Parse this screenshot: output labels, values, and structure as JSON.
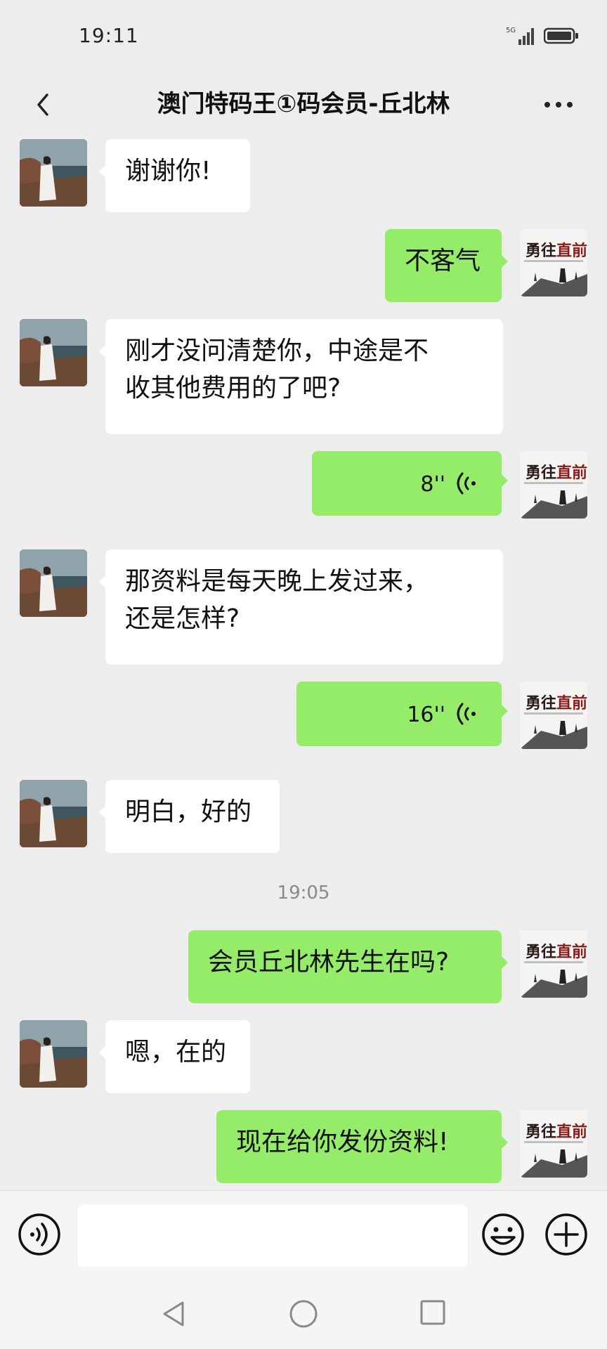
{
  "status_bar": {
    "time": "19:11",
    "network": "5G"
  },
  "header": {
    "title": "澳门特码王①码会员-丘北林"
  },
  "messages": [
    {
      "side": "left",
      "type": "text",
      "text": "谢谢你!"
    },
    {
      "side": "right",
      "type": "text",
      "text": "不客气"
    },
    {
      "side": "left",
      "type": "text",
      "lines": [
        "刚才没问清楚你，中途是不",
        "收其他费用的了吧?"
      ]
    },
    {
      "side": "right",
      "type": "voice",
      "duration": "8''"
    },
    {
      "side": "left",
      "type": "text",
      "lines": [
        "那资料是每天晚上发过来，",
        "还是怎样?"
      ]
    },
    {
      "side": "right",
      "type": "voice",
      "duration": "16''"
    },
    {
      "side": "left",
      "type": "text",
      "text": "明白，好的"
    },
    {
      "type": "timestamp",
      "text": "19:05"
    },
    {
      "side": "right",
      "type": "text",
      "text": "会员丘北林先生在吗?"
    },
    {
      "side": "left",
      "type": "text",
      "text": "嗯，在的"
    },
    {
      "side": "right",
      "type": "text",
      "text": "现在给你发份资料!"
    }
  ],
  "avatars": {
    "contact_icon": "beach-photo-avatar",
    "self_icon": "calligraphy-landscape-avatar",
    "self_calligraphy": "勇往直前"
  },
  "input_bar": {
    "placeholder": ""
  },
  "icons": [
    "back-arrow-icon",
    "more-icon",
    "voice-toggle-icon",
    "emoji-icon",
    "plus-icon",
    "voice-wave-icon",
    "nav-back-icon",
    "nav-home-icon",
    "nav-recent-icon"
  ],
  "colors": {
    "background": "#ededed",
    "outgoing_bubble": "#95ec69",
    "incoming_bubble": "#ffffff",
    "timestamp": "#8a8a8a"
  }
}
